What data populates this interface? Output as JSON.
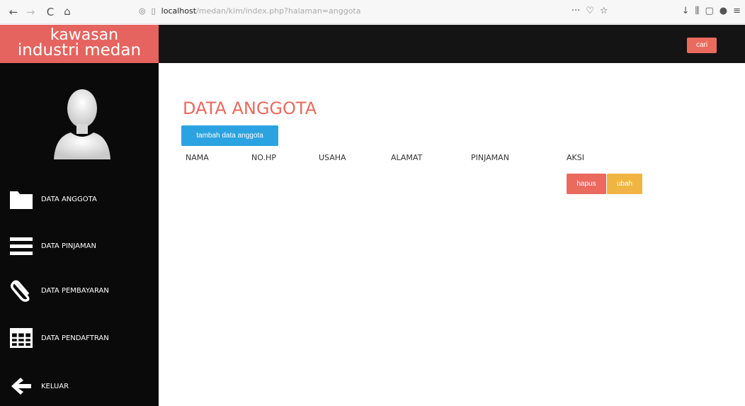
{
  "browser": {
    "back": "←",
    "forward": "→",
    "reload": "C",
    "home": "⌂",
    "url_host": "localhost",
    "url_path": "/medan/kim/index.php?halaman=anggota",
    "more": "···",
    "pocket": "♡",
    "star": "☆",
    "download": "↓",
    "library": "⫼",
    "sidebar_icon": "▢",
    "account": "●",
    "menu": "≡"
  },
  "header": {
    "logo_line1": "kawasan",
    "logo_line2": "industri medan",
    "cari_label": "cari",
    "logo_color": "#e5645f",
    "bar_color": "#141414"
  },
  "sidebar": {
    "items": [
      {
        "label": "DATA ANGGOTA",
        "icon": "folder-icon"
      },
      {
        "label": "DATA PINJAMAN",
        "icon": "list-icon"
      },
      {
        "label": "DATA PEMBAYARAN",
        "icon": "paperclip-icon"
      },
      {
        "label": "DATA PENDAFTRAN",
        "icon": "table-icon"
      },
      {
        "label": "KELUAR",
        "icon": "arrow-left-icon"
      }
    ]
  },
  "main": {
    "title": "DATA ANGGOTA",
    "add_button": "tambah data anggota",
    "columns": [
      "NAMA",
      "NO.HP",
      "USAHA",
      "ALAMAT",
      "PINJAMAN",
      "AKSI"
    ],
    "row_actions": {
      "delete": "hapus",
      "edit": "ubah"
    },
    "accent_color": "#ea6a5e",
    "primary_color": "#2ba3e0",
    "warning_color": "#f0b443"
  }
}
